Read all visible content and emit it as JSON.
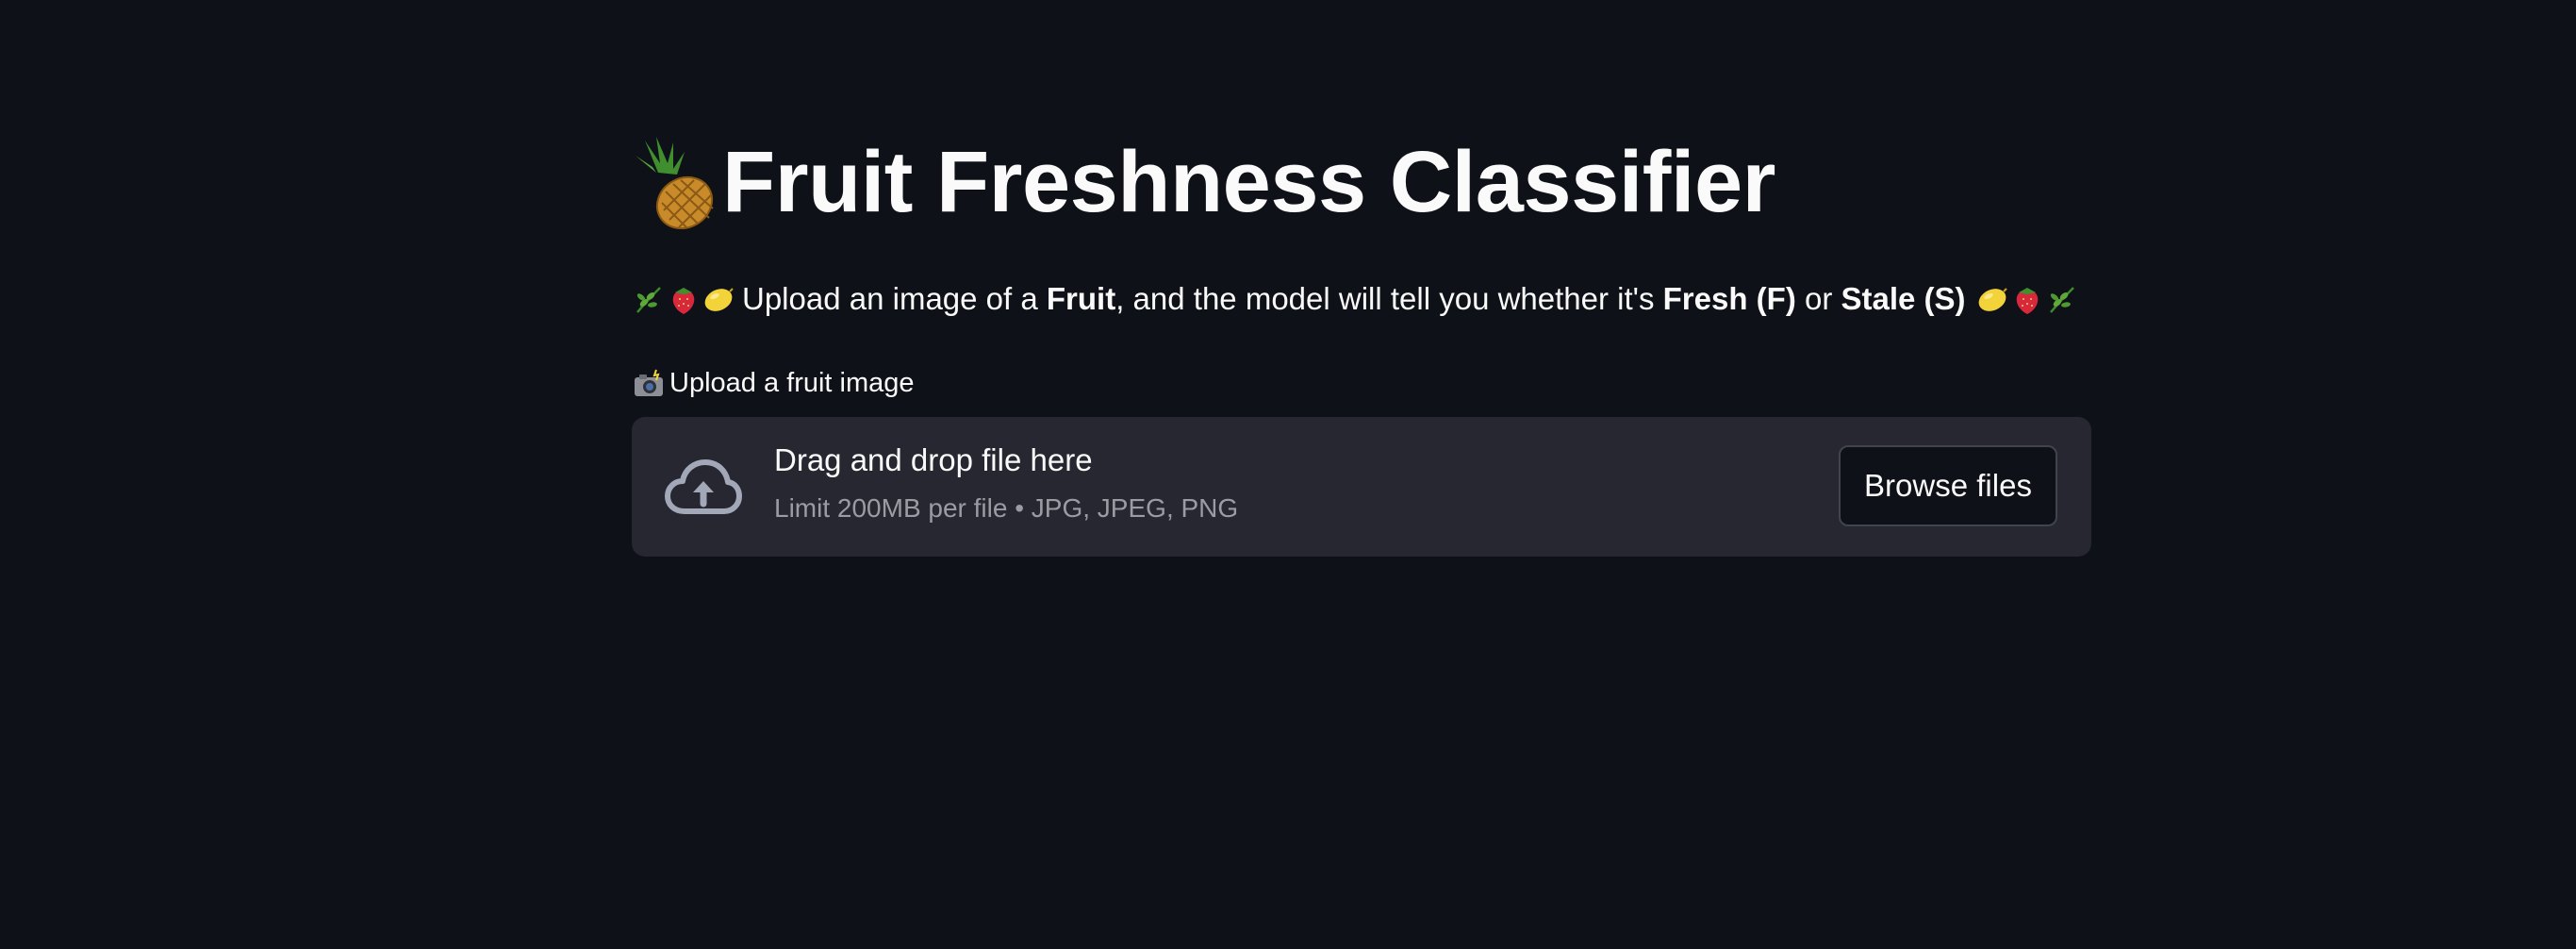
{
  "header": {
    "title": "Fruit Freshness Classifier",
    "title_icon": "pineapple-icon"
  },
  "intro": {
    "leading_icons": [
      "herb-icon",
      "strawberry-icon",
      "lemon-icon"
    ],
    "trailing_icons": [
      "lemon-icon",
      "strawberry-icon",
      "herb-icon"
    ],
    "part1": "Upload an image of a ",
    "bold1": "Fruit",
    "part2": ", and the model will tell you whether it's ",
    "bold2": "Fresh (F)",
    "part3": " or ",
    "bold3": "Stale (S)"
  },
  "uploader": {
    "label_icon": "camera-flash-icon",
    "label": "Upload a fruit image",
    "drop_title": "Drag and drop file here",
    "drop_hint": "Limit 200MB per file • JPG, JPEG, PNG",
    "browse_label": "Browse files",
    "icon": "cloud-upload-icon"
  },
  "colors": {
    "background": "#0e1117",
    "dropzone": "#262730",
    "text": "#fafafa",
    "muted": "#9a9ca4"
  }
}
